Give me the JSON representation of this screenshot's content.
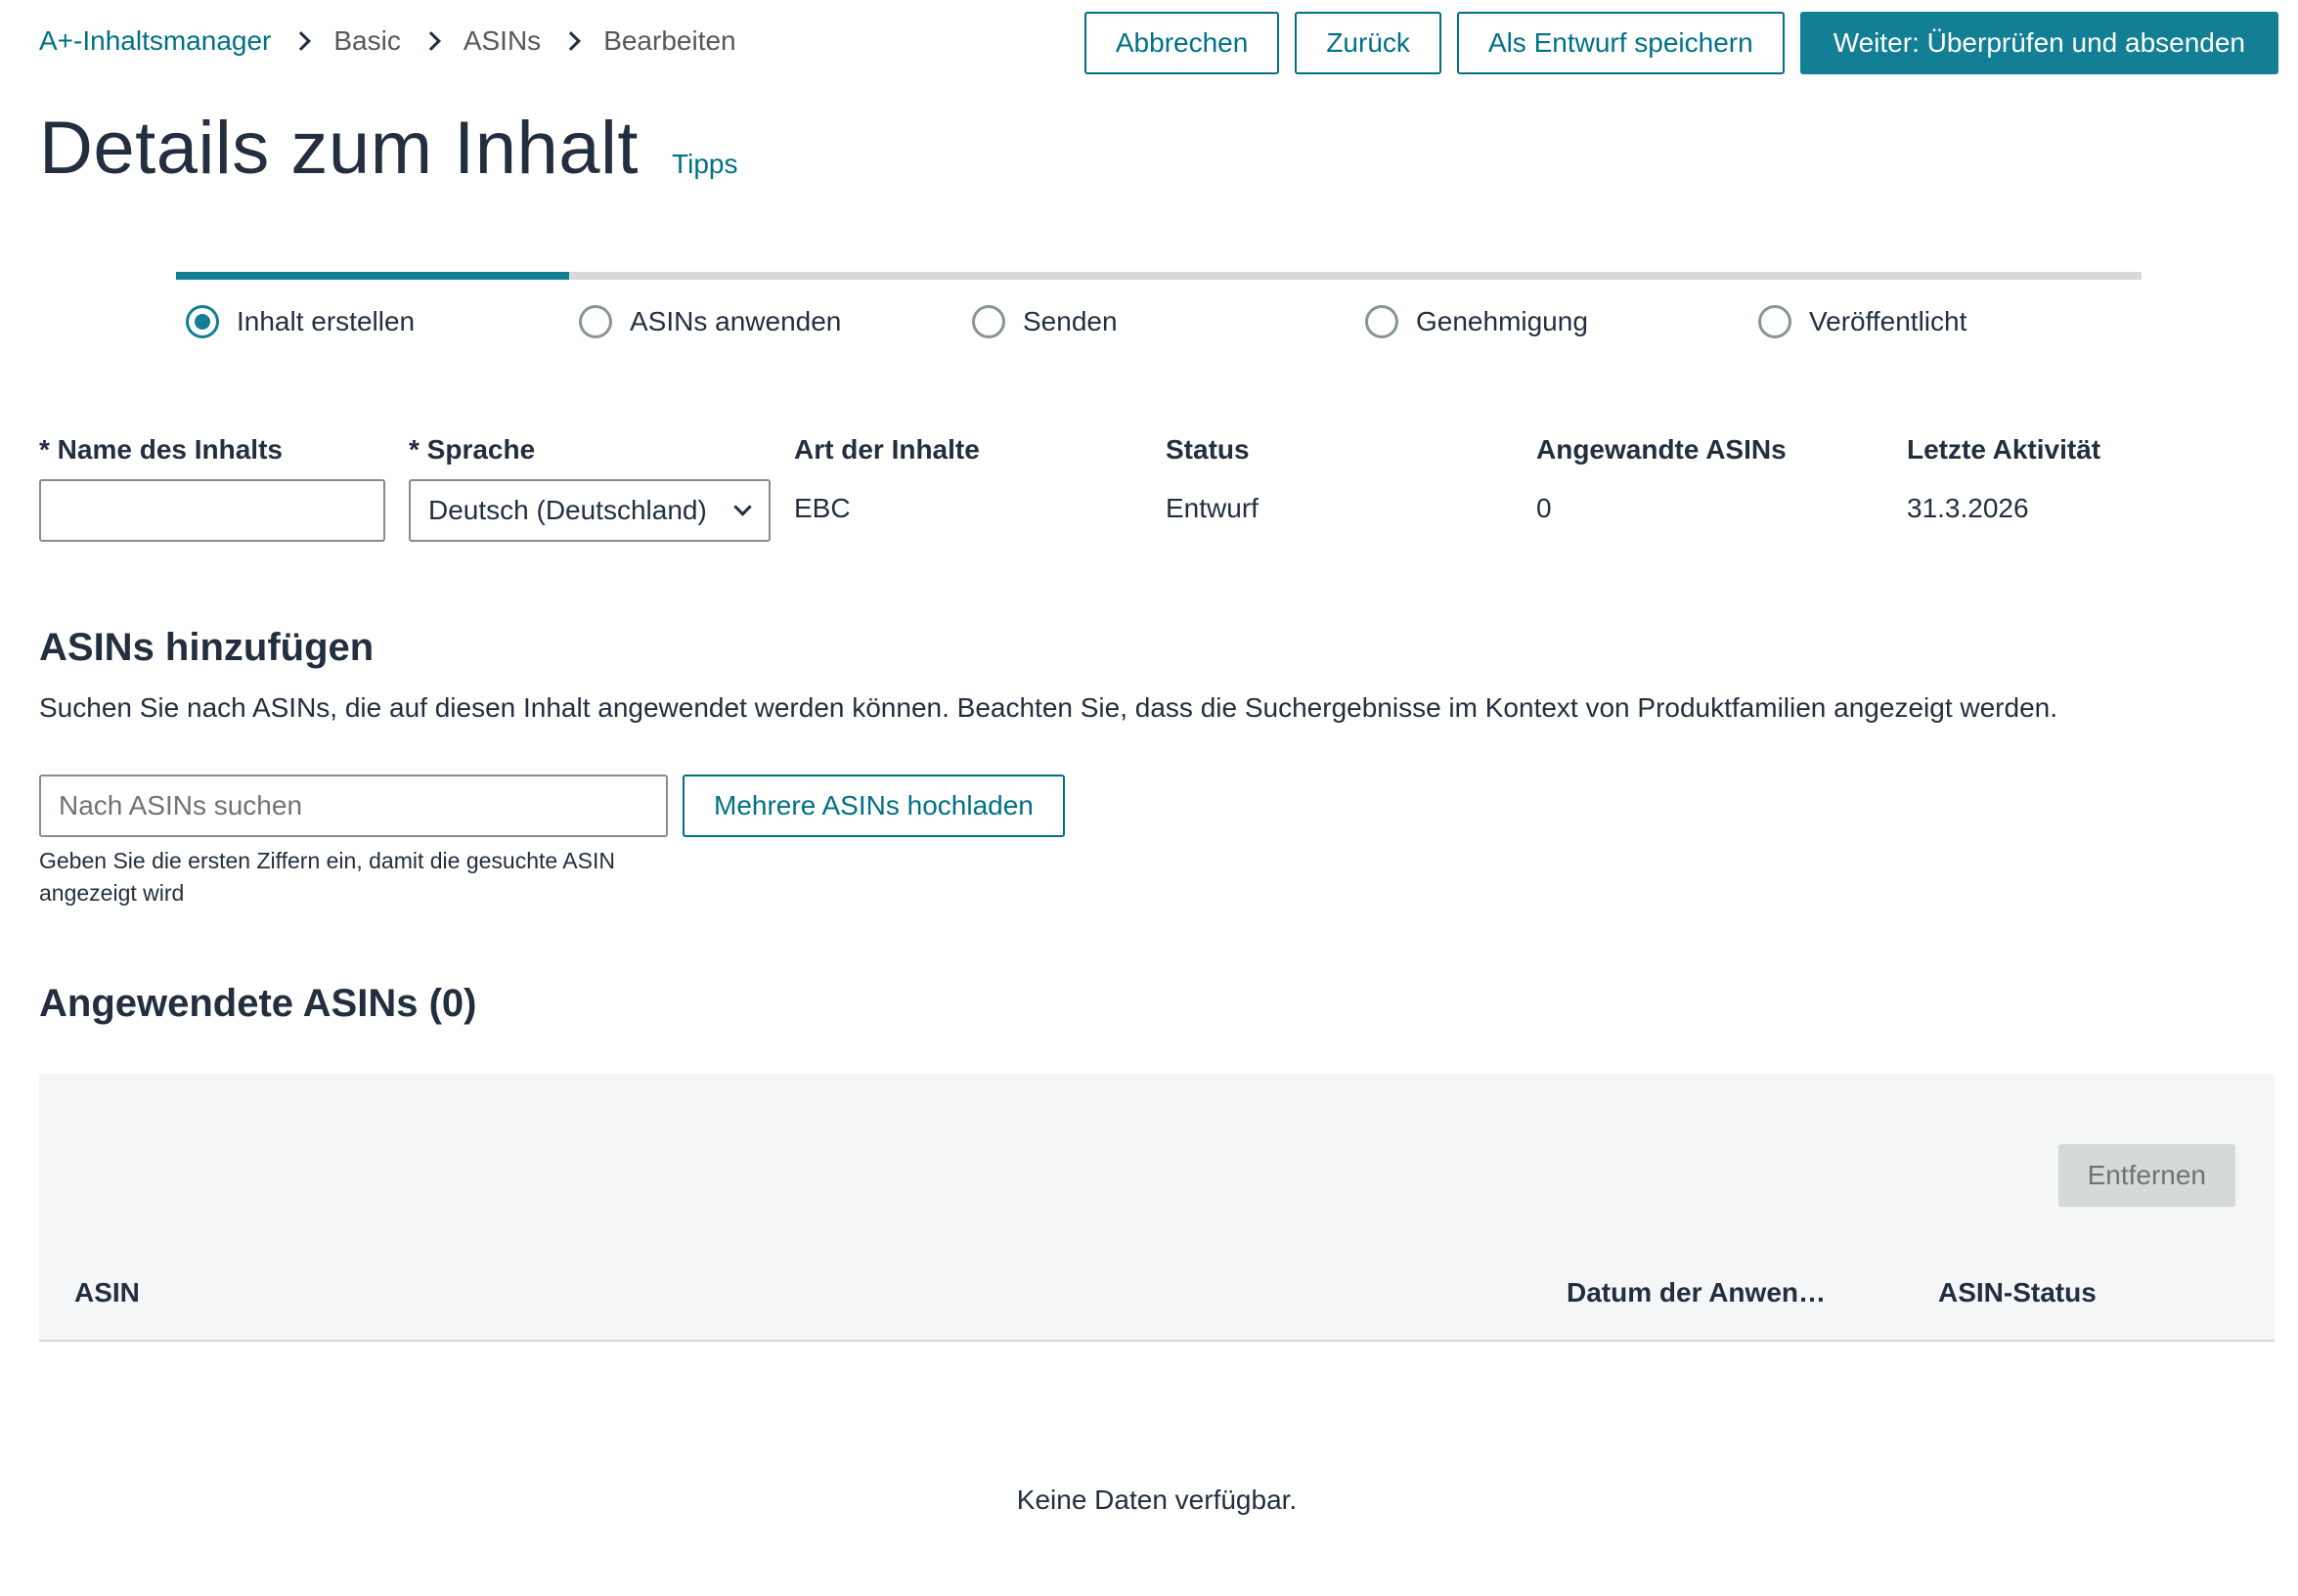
{
  "breadcrumb": {
    "items": [
      "A+-Inhaltsmanager",
      "Basic",
      "ASINs",
      "Bearbeiten"
    ]
  },
  "top_actions": {
    "cancel": "Abbrechen",
    "back": "Zurück",
    "save_draft": "Als Entwurf speichern",
    "next": "Weiter: Überprüfen und absenden"
  },
  "page": {
    "title": "Details zum Inhalt",
    "tips": "Tipps"
  },
  "stepper": {
    "progress": 0.2,
    "steps": [
      {
        "label": "Inhalt erstellen",
        "active": true
      },
      {
        "label": "ASINs anwenden",
        "active": false
      },
      {
        "label": "Senden",
        "active": false
      },
      {
        "label": "Genehmigung",
        "active": false
      },
      {
        "label": "Veröffentlicht",
        "active": false
      }
    ]
  },
  "fields": {
    "name_label": "* Name des Inhalts",
    "name_value": "",
    "language_label": "* Sprache",
    "language_value": "Deutsch (Deutschland)",
    "content_type_label": "Art der Inhalte",
    "content_type_value": "EBC",
    "status_label": "Status",
    "status_value": "Entwurf",
    "applied_label": "Angewandte ASINs",
    "applied_value": "0",
    "last_activity_label": "Letzte Aktivität",
    "last_activity_value": "31.3.2026"
  },
  "add_asins": {
    "title": "ASINs hinzufügen",
    "description": "Suchen Sie nach ASINs, die auf diesen Inhalt angewendet werden können. Beachten Sie, dass die Suchergebnisse im Kontext von Produktfamilien angezeigt werden.",
    "search_placeholder": "Nach ASINs suchen",
    "upload_button": "Mehrere ASINs hochladen",
    "hint": "Geben Sie die ersten Ziffern ein, damit die gesuchte ASIN angezeigt wird"
  },
  "applied_asins": {
    "title": "Angewendete ASINs (0)",
    "remove_button": "Entfernen",
    "columns": [
      "ASIN",
      "Datum der Anwen…",
      "ASIN-Status"
    ],
    "empty_message": "Keine Daten verfügbar."
  },
  "colors": {
    "accent": "#127f94",
    "link": "#007185",
    "text": "#232f3e",
    "panel": "#f5f6f7"
  }
}
